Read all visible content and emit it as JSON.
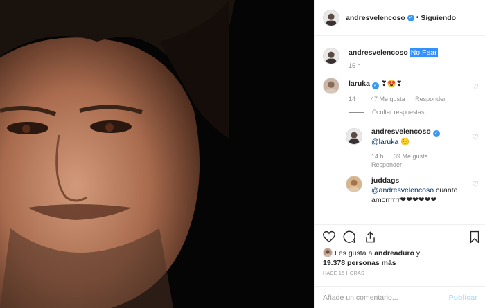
{
  "post": {
    "author": "andresvelencoso",
    "follow_state": "Siguiendo",
    "caption": "No Fear",
    "caption_time": "15 h"
  },
  "comments": [
    {
      "user": "laruka",
      "text": "❣😍❣",
      "time": "14 h",
      "likes": "47 Me gusta",
      "reply": "Responder",
      "hide_replies": "Ocultar respuestas",
      "verified": true
    },
    {
      "user": "andresvelencoso",
      "mention": "@laruka",
      "text": "😉",
      "time": "14 h",
      "likes": "39 Me gusta",
      "reply": "Responder",
      "verified": true
    },
    {
      "user": "juddags",
      "mention": "@andresvelencoso",
      "text": "cuanto amorrrrrr❤❤❤❤❤❤",
      "verified": false
    }
  ],
  "likes_line": {
    "prefix": "Les gusta a",
    "user": "andreaduro",
    "middle": "y",
    "count": "19.378 personas más"
  },
  "timestamp": "HACE 15 HORAS",
  "add_comment": {
    "placeholder": "Añade un comentario...",
    "publish": "Publicar"
  },
  "icons": [
    "verified-badge-icon",
    "heart-icon",
    "comment-icon",
    "share-icon",
    "bookmark-icon"
  ],
  "colors": {
    "accent": "#3897f0",
    "mention": "#003569",
    "highlight": "#3390ff",
    "publish_disabled": "#b2dffc"
  }
}
